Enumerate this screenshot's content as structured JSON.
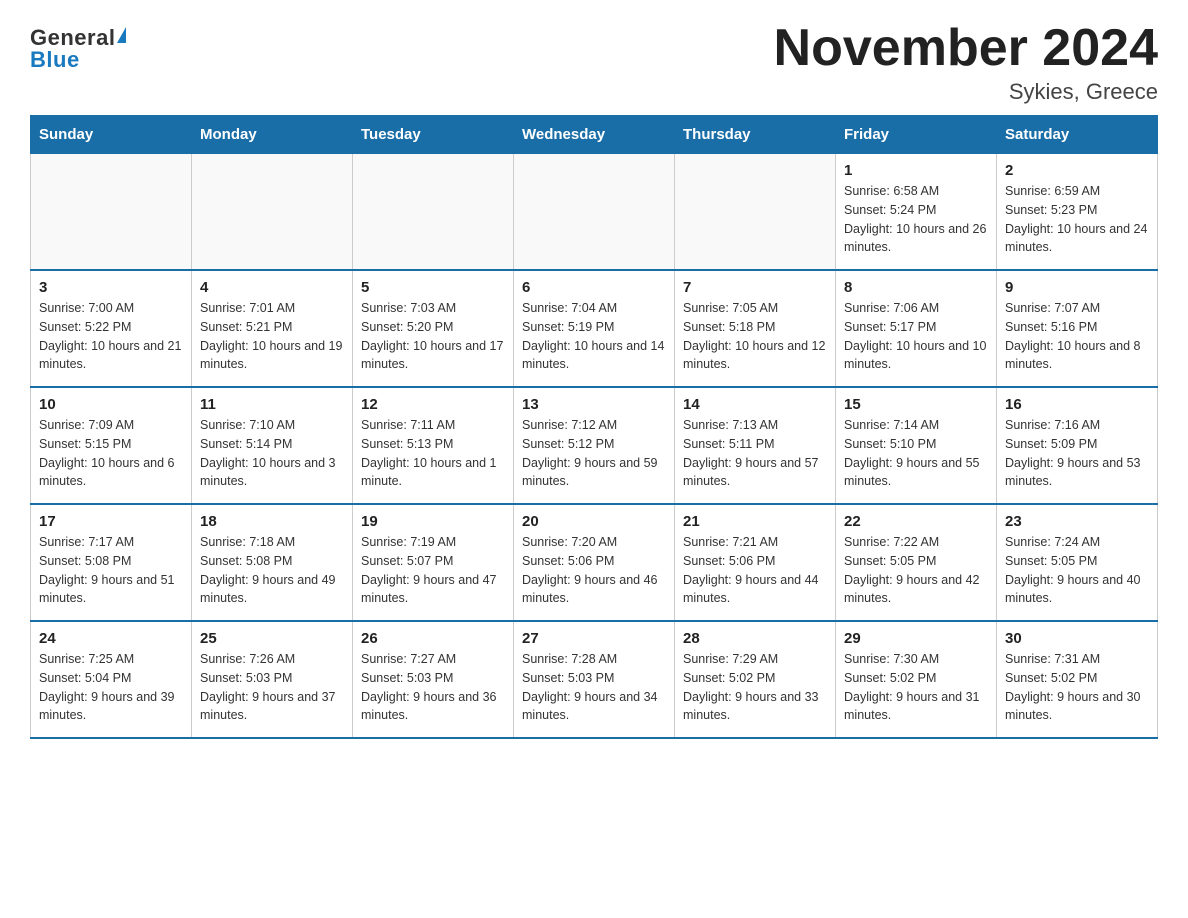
{
  "header": {
    "logo_general": "General",
    "logo_blue": "Blue",
    "month_title": "November 2024",
    "location": "Sykies, Greece"
  },
  "days_of_week": [
    "Sunday",
    "Monday",
    "Tuesday",
    "Wednesday",
    "Thursday",
    "Friday",
    "Saturday"
  ],
  "weeks": [
    [
      {
        "day": "",
        "info": ""
      },
      {
        "day": "",
        "info": ""
      },
      {
        "day": "",
        "info": ""
      },
      {
        "day": "",
        "info": ""
      },
      {
        "day": "",
        "info": ""
      },
      {
        "day": "1",
        "info": "Sunrise: 6:58 AM\nSunset: 5:24 PM\nDaylight: 10 hours and 26 minutes."
      },
      {
        "day": "2",
        "info": "Sunrise: 6:59 AM\nSunset: 5:23 PM\nDaylight: 10 hours and 24 minutes."
      }
    ],
    [
      {
        "day": "3",
        "info": "Sunrise: 7:00 AM\nSunset: 5:22 PM\nDaylight: 10 hours and 21 minutes."
      },
      {
        "day": "4",
        "info": "Sunrise: 7:01 AM\nSunset: 5:21 PM\nDaylight: 10 hours and 19 minutes."
      },
      {
        "day": "5",
        "info": "Sunrise: 7:03 AM\nSunset: 5:20 PM\nDaylight: 10 hours and 17 minutes."
      },
      {
        "day": "6",
        "info": "Sunrise: 7:04 AM\nSunset: 5:19 PM\nDaylight: 10 hours and 14 minutes."
      },
      {
        "day": "7",
        "info": "Sunrise: 7:05 AM\nSunset: 5:18 PM\nDaylight: 10 hours and 12 minutes."
      },
      {
        "day": "8",
        "info": "Sunrise: 7:06 AM\nSunset: 5:17 PM\nDaylight: 10 hours and 10 minutes."
      },
      {
        "day": "9",
        "info": "Sunrise: 7:07 AM\nSunset: 5:16 PM\nDaylight: 10 hours and 8 minutes."
      }
    ],
    [
      {
        "day": "10",
        "info": "Sunrise: 7:09 AM\nSunset: 5:15 PM\nDaylight: 10 hours and 6 minutes."
      },
      {
        "day": "11",
        "info": "Sunrise: 7:10 AM\nSunset: 5:14 PM\nDaylight: 10 hours and 3 minutes."
      },
      {
        "day": "12",
        "info": "Sunrise: 7:11 AM\nSunset: 5:13 PM\nDaylight: 10 hours and 1 minute."
      },
      {
        "day": "13",
        "info": "Sunrise: 7:12 AM\nSunset: 5:12 PM\nDaylight: 9 hours and 59 minutes."
      },
      {
        "day": "14",
        "info": "Sunrise: 7:13 AM\nSunset: 5:11 PM\nDaylight: 9 hours and 57 minutes."
      },
      {
        "day": "15",
        "info": "Sunrise: 7:14 AM\nSunset: 5:10 PM\nDaylight: 9 hours and 55 minutes."
      },
      {
        "day": "16",
        "info": "Sunrise: 7:16 AM\nSunset: 5:09 PM\nDaylight: 9 hours and 53 minutes."
      }
    ],
    [
      {
        "day": "17",
        "info": "Sunrise: 7:17 AM\nSunset: 5:08 PM\nDaylight: 9 hours and 51 minutes."
      },
      {
        "day": "18",
        "info": "Sunrise: 7:18 AM\nSunset: 5:08 PM\nDaylight: 9 hours and 49 minutes."
      },
      {
        "day": "19",
        "info": "Sunrise: 7:19 AM\nSunset: 5:07 PM\nDaylight: 9 hours and 47 minutes."
      },
      {
        "day": "20",
        "info": "Sunrise: 7:20 AM\nSunset: 5:06 PM\nDaylight: 9 hours and 46 minutes."
      },
      {
        "day": "21",
        "info": "Sunrise: 7:21 AM\nSunset: 5:06 PM\nDaylight: 9 hours and 44 minutes."
      },
      {
        "day": "22",
        "info": "Sunrise: 7:22 AM\nSunset: 5:05 PM\nDaylight: 9 hours and 42 minutes."
      },
      {
        "day": "23",
        "info": "Sunrise: 7:24 AM\nSunset: 5:05 PM\nDaylight: 9 hours and 40 minutes."
      }
    ],
    [
      {
        "day": "24",
        "info": "Sunrise: 7:25 AM\nSunset: 5:04 PM\nDaylight: 9 hours and 39 minutes."
      },
      {
        "day": "25",
        "info": "Sunrise: 7:26 AM\nSunset: 5:03 PM\nDaylight: 9 hours and 37 minutes."
      },
      {
        "day": "26",
        "info": "Sunrise: 7:27 AM\nSunset: 5:03 PM\nDaylight: 9 hours and 36 minutes."
      },
      {
        "day": "27",
        "info": "Sunrise: 7:28 AM\nSunset: 5:03 PM\nDaylight: 9 hours and 34 minutes."
      },
      {
        "day": "28",
        "info": "Sunrise: 7:29 AM\nSunset: 5:02 PM\nDaylight: 9 hours and 33 minutes."
      },
      {
        "day": "29",
        "info": "Sunrise: 7:30 AM\nSunset: 5:02 PM\nDaylight: 9 hours and 31 minutes."
      },
      {
        "day": "30",
        "info": "Sunrise: 7:31 AM\nSunset: 5:02 PM\nDaylight: 9 hours and 30 minutes."
      }
    ]
  ]
}
